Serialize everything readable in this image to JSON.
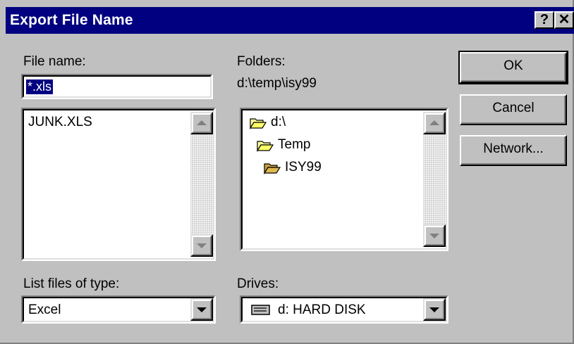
{
  "window": {
    "title": "Export File Name",
    "help_label": "?",
    "close_label": "✕"
  },
  "file_name": {
    "label": "File name:",
    "value": "*.xls",
    "files": [
      "JUNK.XLS"
    ]
  },
  "folders": {
    "label": "Folders:",
    "current_path": "d:\\temp\\isy99",
    "tree": [
      {
        "label": "d:\\",
        "icon": "open-folder-icon"
      },
      {
        "label": "Temp",
        "icon": "open-folder-icon"
      },
      {
        "label": "ISY99",
        "icon": "open-folder-icon"
      }
    ]
  },
  "file_type": {
    "label": "List files of type:",
    "selected": "Excel"
  },
  "drives": {
    "label": "Drives:",
    "selected": "d: HARD DISK",
    "icon": "hard-disk-icon"
  },
  "buttons": {
    "ok": "OK",
    "cancel": "Cancel",
    "network": "Network..."
  },
  "colors": {
    "titlebar": "#000080",
    "face": "#c0c0c0",
    "selection": "#000080"
  }
}
